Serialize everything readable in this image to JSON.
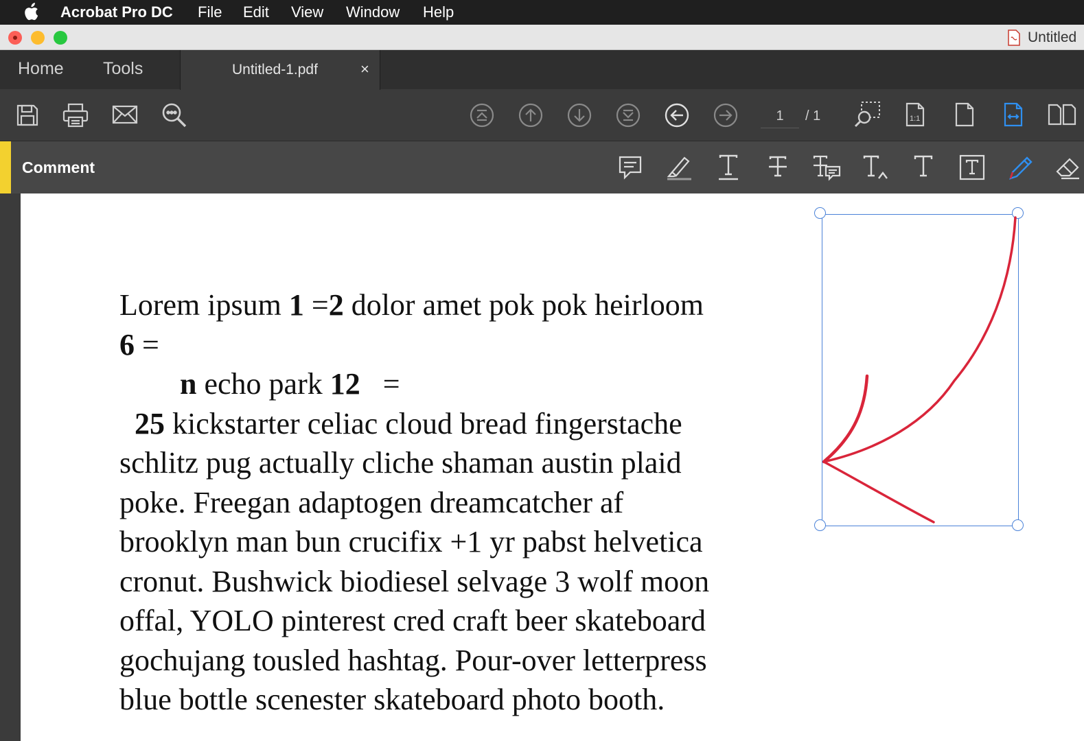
{
  "menubar": {
    "apple_icon": "apple-icon",
    "app_name": "Acrobat Pro DC",
    "items": [
      "File",
      "Edit",
      "View",
      "Window",
      "Help"
    ]
  },
  "window": {
    "document_title": "Untitled",
    "traffic_lights": {
      "close": "#fc5f57",
      "minimize": "#fdbc2e",
      "zoom": "#28c840"
    }
  },
  "tabs": {
    "home": "Home",
    "tools": "Tools",
    "document": "Untitled-1.pdf",
    "close_glyph": "×"
  },
  "toolbar": {
    "left_icons": [
      "save-icon",
      "print-icon",
      "email-icon",
      "search-icon"
    ],
    "nav_icons": [
      "first-page-icon",
      "previous-page-icon",
      "next-page-icon",
      "last-page-icon",
      "back-icon",
      "forward-icon"
    ],
    "page_current": "1",
    "page_total": "/ 1",
    "right_icons": [
      "marquee-zoom-icon",
      "actual-size-icon",
      "fit-page-icon",
      "fit-width-icon",
      "two-page-icon"
    ],
    "active_color": "#2f8ff0"
  },
  "comment": {
    "label": "Comment",
    "accent_color": "#f3d12f",
    "tools": [
      "sticky-note-icon",
      "highlight-icon",
      "underline-icon",
      "strikethrough-icon",
      "replace-text-icon",
      "insert-text-icon",
      "add-text-icon",
      "text-box-icon",
      "pencil-icon",
      "eraser-icon"
    ],
    "ink_color": "#d9253a"
  },
  "document": {
    "lines": [
      {
        "runs": [
          {
            "t": "Lorem ipsum ",
            "b": false
          },
          {
            "t": "1",
            "b": true
          },
          {
            "t": " =",
            "b": false
          },
          {
            "t": "2",
            "b": true
          },
          {
            "t": " dolor amet pok pok heirloom",
            "b": false
          }
        ]
      },
      {
        "runs": [
          {
            "t": "6",
            "b": true
          },
          {
            "t": " =",
            "b": false
          }
        ]
      },
      {
        "runs": [
          {
            "t": "        ",
            "b": false
          },
          {
            "t": "n",
            "b": true
          },
          {
            "t": " echo park ",
            "b": false
          },
          {
            "t": "12",
            "b": true
          },
          {
            "t": "   =",
            "b": false
          }
        ]
      },
      {
        "runs": [
          {
            "t": "  ",
            "b": false
          },
          {
            "t": "25",
            "b": true
          },
          {
            "t": " kickstarter celiac cloud bread fingerstache",
            "b": false
          }
        ]
      },
      {
        "runs": [
          {
            "t": "schlitz pug actually cliche shaman austin plaid",
            "b": false
          }
        ]
      },
      {
        "runs": [
          {
            "t": "poke. Freegan adaptogen dreamcatcher af",
            "b": false
          }
        ]
      },
      {
        "runs": [
          {
            "t": "brooklyn man bun crucifix +1 yr pabst helvetica",
            "b": false
          }
        ]
      },
      {
        "runs": [
          {
            "t": "cronut. Bushwick biodiesel selvage 3 wolf moon",
            "b": false
          }
        ]
      },
      {
        "runs": [
          {
            "t": "offal, YOLO pinterest cred craft beer skateboard",
            "b": false
          }
        ]
      },
      {
        "runs": [
          {
            "t": "gochujang tousled hashtag. Pour-over letterpress",
            "b": false
          }
        ]
      },
      {
        "runs": [
          {
            "t": "blue bottle scenester skateboard photo booth.",
            "b": false
          }
        ]
      }
    ]
  }
}
